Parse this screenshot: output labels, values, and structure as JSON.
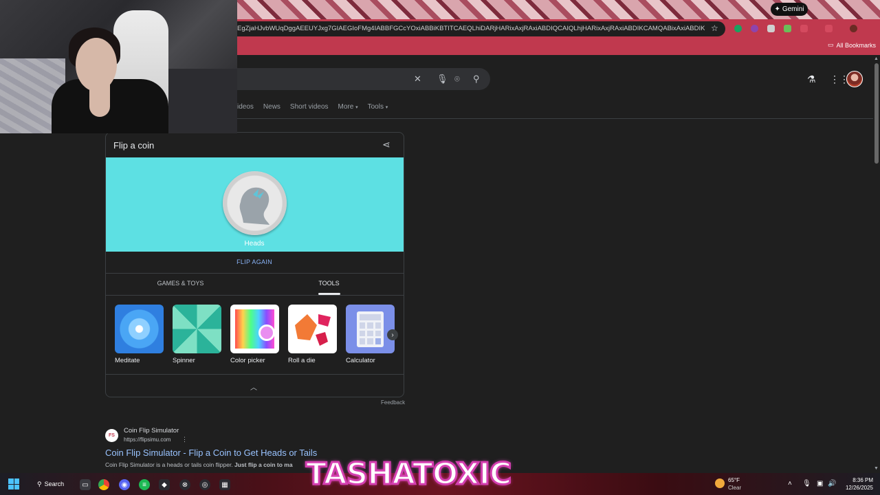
{
  "browser": {
    "gemini_label": "Gemini",
    "url": "EgZjaHJvbWUqDggAEEUYJxg7GIAEGIoFMg4IABBFGCcYOxiABBiKBTITCAEQLhiDARjHARixAxjRAxiABDIQCAIQLhjHARixAxjRAxiABDIKCAMQABixAxiABDIKCAQQABixAx...",
    "all_bookmarks_label": "All Bookmarks"
  },
  "search": {
    "nav_tabs": [
      "ideos",
      "News",
      "Short videos",
      "More",
      "Tools"
    ]
  },
  "card": {
    "title": "Flip a coin",
    "result_label": "Heads",
    "flip_again_label": "FLIP AGAIN",
    "tabs": [
      "GAMES & TOYS",
      "TOOLS"
    ],
    "tools": [
      {
        "label": "Meditate"
      },
      {
        "label": "Spinner"
      },
      {
        "label": "Color picker"
      },
      {
        "label": "Roll a die"
      },
      {
        "label": "Calculator"
      }
    ],
    "feedback_label": "Feedback"
  },
  "result": {
    "favicon_text": "FS",
    "site_name": "Coin Flip Simulator",
    "site_url": "https://flipsimu.com",
    "title": "Coin Flip Simulator - Flip a Coin to Get Heads or Tails",
    "snippet_start": "Coin Flip Simulator is a heads or tails coin flipper. ",
    "snippet_bold": "Just flip a coin to ma"
  },
  "overlay": {
    "brand_text": "TASHATOXIC"
  },
  "taskbar": {
    "search_label": "Search",
    "weather_temp": "65°F",
    "weather_desc": "Clear",
    "time": "8:36 PM",
    "date": "12/26/2025"
  },
  "colors": {
    "coin_bg": "#5de0e3",
    "link": "#8ab4f8",
    "toolbar": "#c0394e",
    "brand_stroke": "#d43fb0"
  }
}
